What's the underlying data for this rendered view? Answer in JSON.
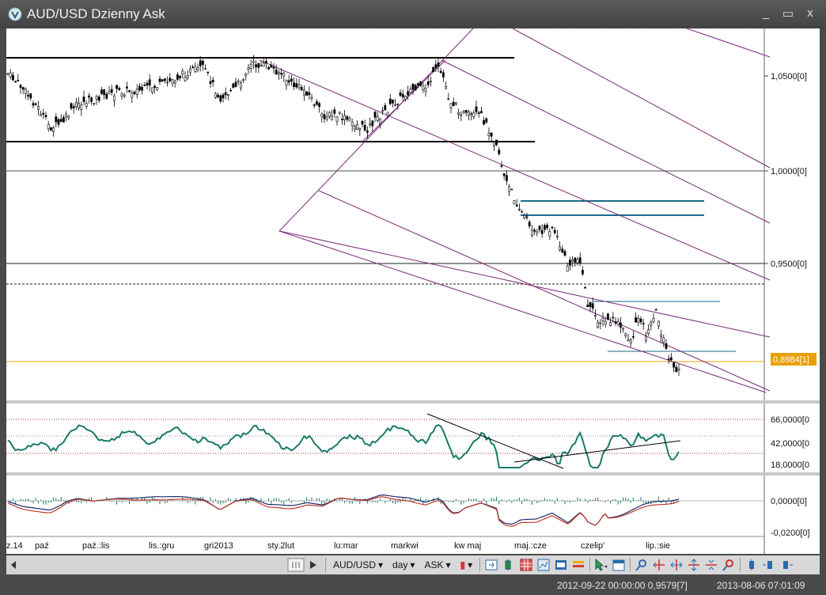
{
  "window": {
    "title": "AUD/USD Dzienny Ask",
    "minimize_glyph": "_",
    "maximize_glyph": "▭",
    "close_glyph": "x"
  },
  "price_axis": {
    "labels": [
      "1,0500[0]",
      "1,0000[0]",
      "0,9500[0]"
    ],
    "current_price_label": "0,8984[1]",
    "current_price_color": "#e8a000"
  },
  "rsi_axis": {
    "labels": [
      "66,0000[0",
      "42,0000[0",
      "18,0000[0"
    ]
  },
  "macd_axis": {
    "labels": [
      "0,0000[0]",
      "-0,0200[0]"
    ]
  },
  "time_axis": {
    "labels": [
      "z.14",
      "paź",
      "paź.:lis",
      "lis.:gru",
      "gri2013",
      "sty.2lut",
      "lu:mar",
      "markwi",
      "kw maj",
      "maj.:cze",
      "czelip'",
      "lip.:sie"
    ]
  },
  "toolbar": {
    "instrument": "AUD/USD",
    "period": "day",
    "side": "ASK"
  },
  "statusbar": {
    "cursor_info": "2012-09-22 00:00:00  0,9579[7]",
    "server_time": "2013-08-06 07:01:09"
  },
  "colors": {
    "channel": "#7a2a7a",
    "rsi_line": "#1a7a6a",
    "macd_line": "#1a2a6a",
    "signal_line": "#c0392b",
    "horizontal_blue": "#1a6a8a",
    "candle": "#000000"
  },
  "icons": [
    "scroll-thumb-icon",
    "play-right-icon",
    "dropdown-arrow-icon",
    "candle-type-icon",
    "chart-tools-icon",
    "cursor-icon",
    "zoom-icon",
    "crosshair-icon"
  ]
}
